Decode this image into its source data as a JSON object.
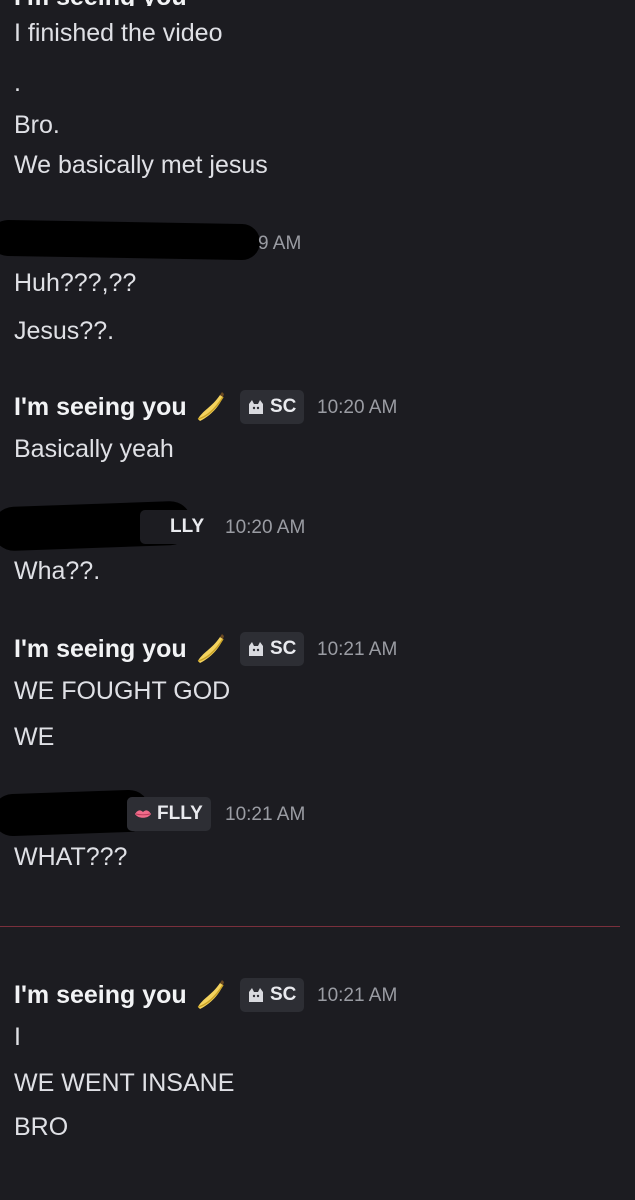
{
  "top": {
    "messages": [
      "I finished the video",
      ".",
      "Bro.",
      "We basically met jesus"
    ]
  },
  "group2": {
    "timestamp_partial": "9 AM",
    "messages": [
      "Huh???,??",
      "Jesus??."
    ]
  },
  "group3": {
    "author": "I'm seeing you",
    "tag": "SC",
    "timestamp": "10:20 AM",
    "messages": [
      "Basically yeah"
    ]
  },
  "group4": {
    "tag_partial": "LLY",
    "timestamp": "10:20 AM",
    "messages": [
      "Wha??."
    ]
  },
  "group5": {
    "author": "I'm seeing you",
    "tag": "SC",
    "timestamp": "10:21 AM",
    "messages": [
      "WE FOUGHT GOD",
      "WE"
    ]
  },
  "group6": {
    "tag": "FLLY",
    "timestamp": "10:21 AM",
    "messages": [
      "WHAT???"
    ]
  },
  "group7": {
    "author": "I'm seeing you",
    "tag": "SC",
    "timestamp": "10:21 AM",
    "messages": [
      "I",
      "WE WENT INSANE",
      "BRO"
    ]
  },
  "icons": {
    "banana": "banana-icon",
    "sc_tag": "cat-icon",
    "flly_tag": "lips-icon"
  },
  "colors": {
    "background": "#1c1c21",
    "new_messages_divider": "#7a2f3c"
  }
}
